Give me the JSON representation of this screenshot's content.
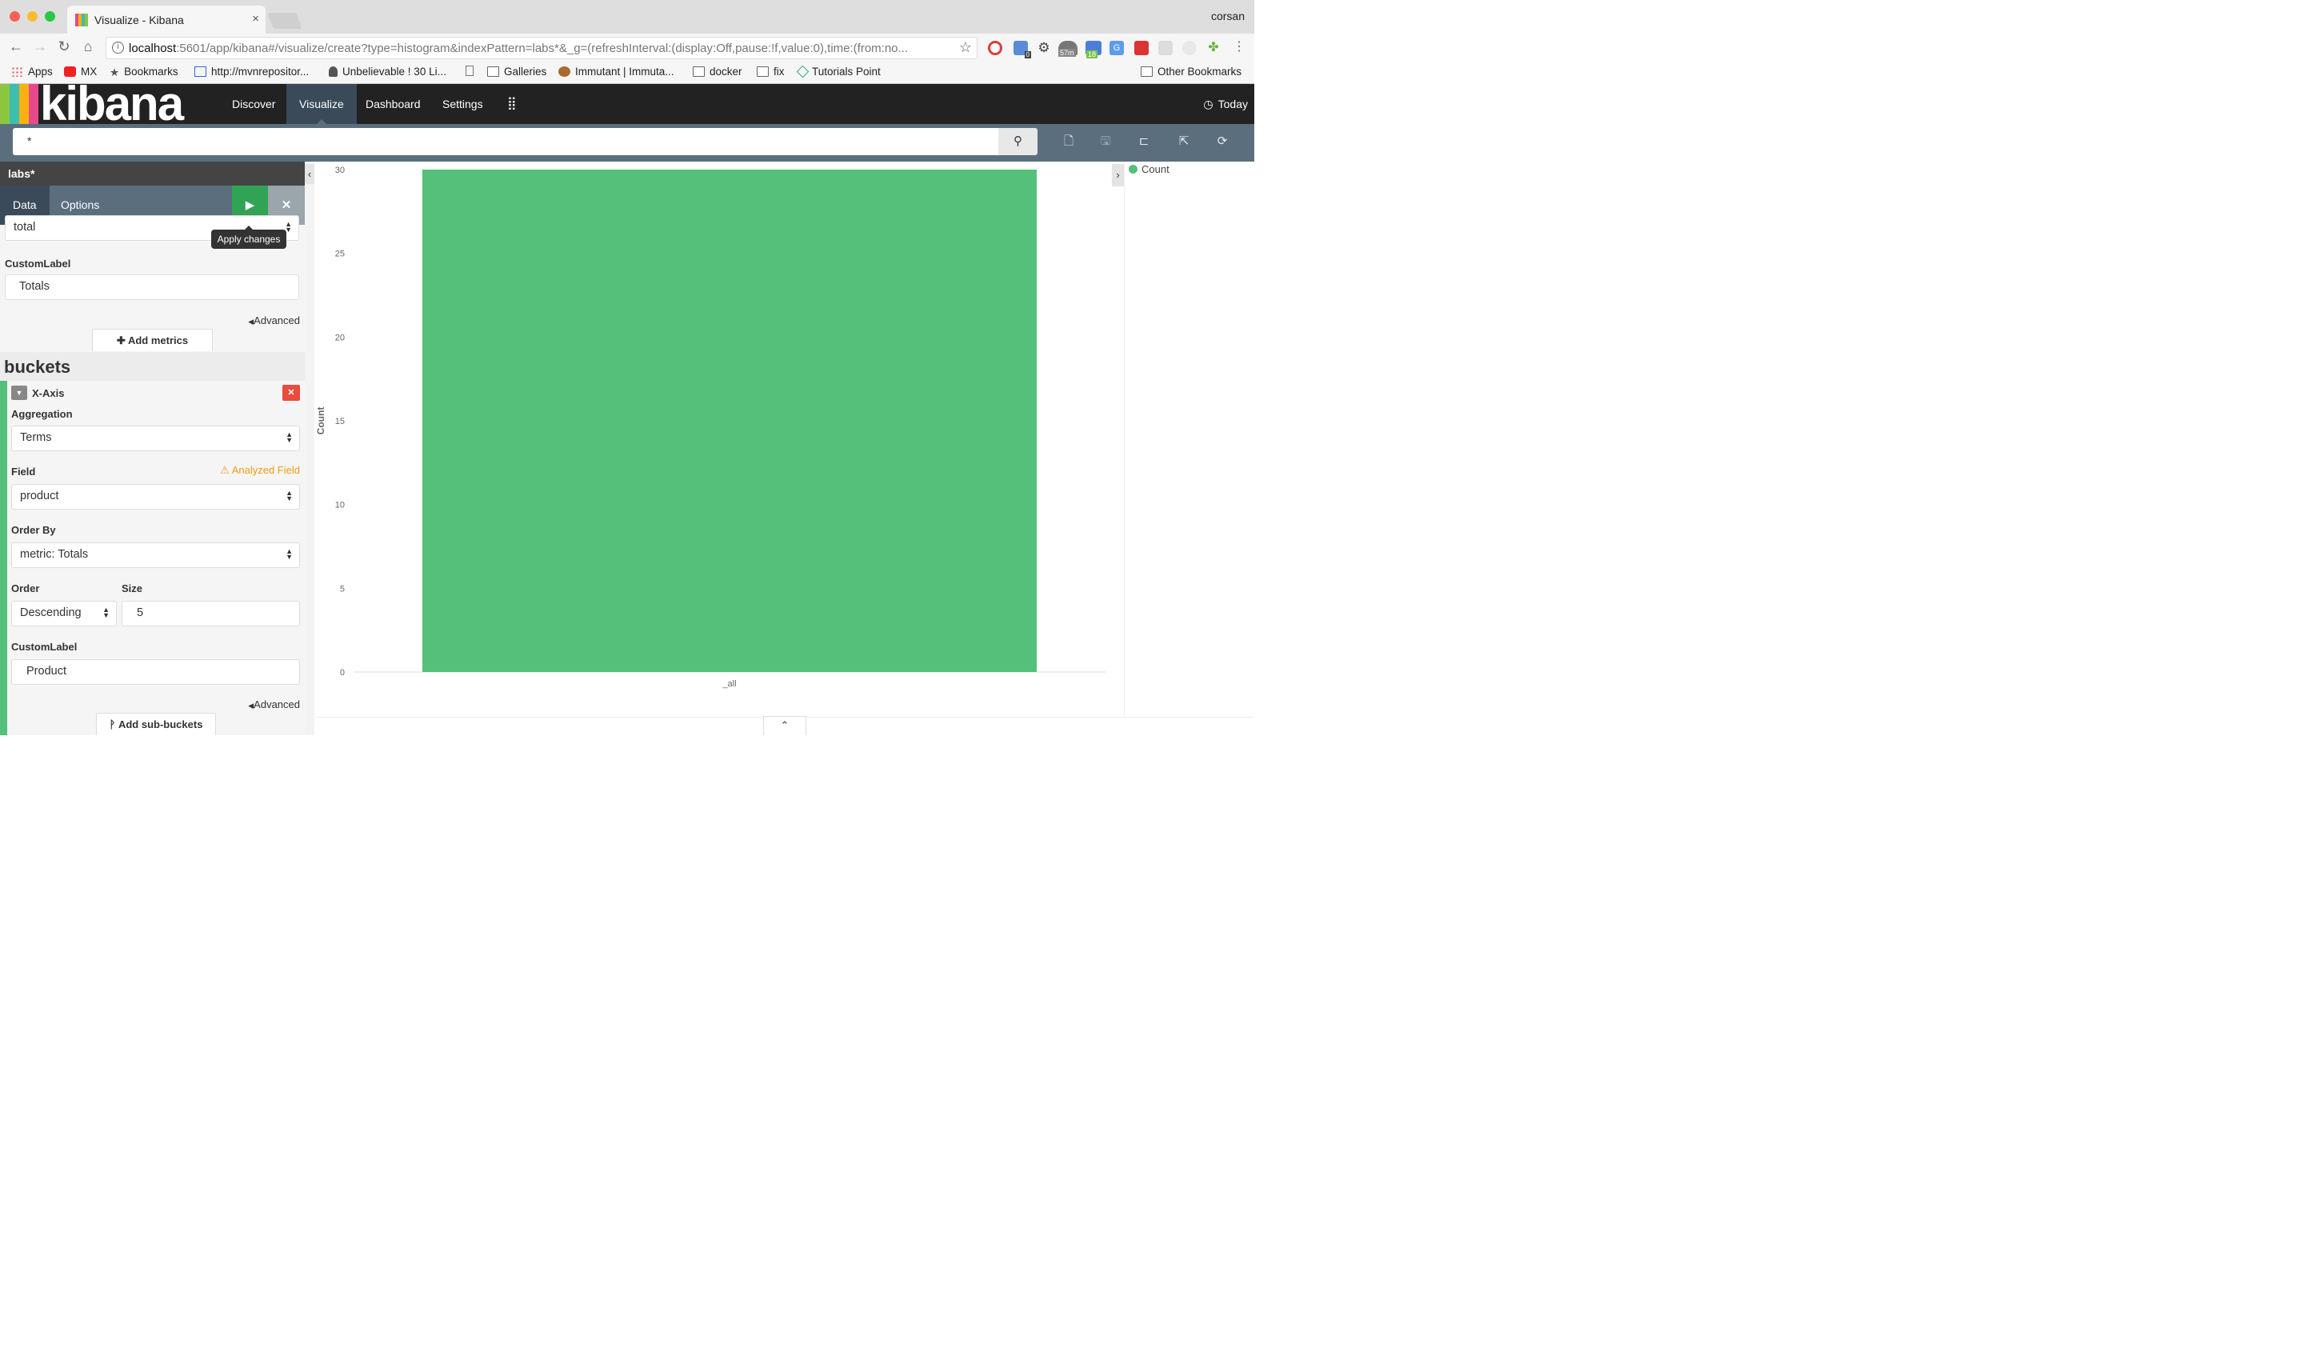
{
  "browser": {
    "tab_title": "Visualize - Kibana",
    "tab_close": "×",
    "profile_name": "corsan",
    "url_host": "localhost",
    "url_rest": ":5601/app/kibana#/visualize/create?type=histogram&indexPattern=labs*&_g=(refreshInterval:(display:Off,pause:!f,value:0),time:(from:no...",
    "bookmarks": [
      "Apps",
      "MX",
      "Bookmarks",
      "http://mvnrepositor...",
      "Unbelievable ! 30 Li...",
      "",
      "Galleries",
      "Immutant | Immuta...",
      "docker",
      "fix",
      "Tutorials Point"
    ],
    "other_bookmarks": "Other Bookmarks",
    "ext_badges": {
      "timer": "57m",
      "calendar": "18",
      "count": "0"
    }
  },
  "kibana": {
    "logo_text": "kibana",
    "nav": [
      "Discover",
      "Visualize",
      "Dashboard",
      "Settings"
    ],
    "time_label": "Today",
    "query": "*",
    "colors": {
      "accent_green": "#54c07a",
      "nav_dark": "#222222",
      "toolbar": "#5a6e7e",
      "warning": "#f39c12",
      "danger": "#e74c3c"
    }
  },
  "sidebar": {
    "index_pattern": "labs*",
    "tabs": [
      "Data",
      "Options"
    ],
    "apply_tooltip": "Apply changes",
    "metric": {
      "field_value": "total",
      "custom_label_title": "CustomLabel",
      "custom_label_value": "Totals",
      "advanced": "Advanced",
      "add_metrics": "Add metrics"
    },
    "buckets": {
      "title": "buckets",
      "agg_title": "X-Axis",
      "aggregation_label": "Aggregation",
      "aggregation_value": "Terms",
      "field_label": "Field",
      "field_warning": "Analyzed Field",
      "field_value": "product",
      "order_by_label": "Order By",
      "order_by_value": "metric: Totals",
      "order_label": "Order",
      "order_value": "Descending",
      "size_label": "Size",
      "size_value": "5",
      "custom_label_title": "CustomLabel",
      "custom_label_value": "Product",
      "advanced": "Advanced",
      "add_sub_buckets": "Add sub-buckets"
    }
  },
  "legend": {
    "items": [
      {
        "label": "Count",
        "color": "#54c07a"
      }
    ]
  },
  "chart_data": {
    "type": "bar",
    "categories": [
      "_all"
    ],
    "series": [
      {
        "name": "Count",
        "values": [
          30
        ],
        "color": "#54c07a"
      }
    ],
    "ylabel": "Count",
    "xlabel": "",
    "ylim": [
      0,
      30
    ],
    "yticks": [
      0,
      5,
      10,
      15,
      20,
      25,
      30
    ],
    "grid": false,
    "legend": "right"
  }
}
